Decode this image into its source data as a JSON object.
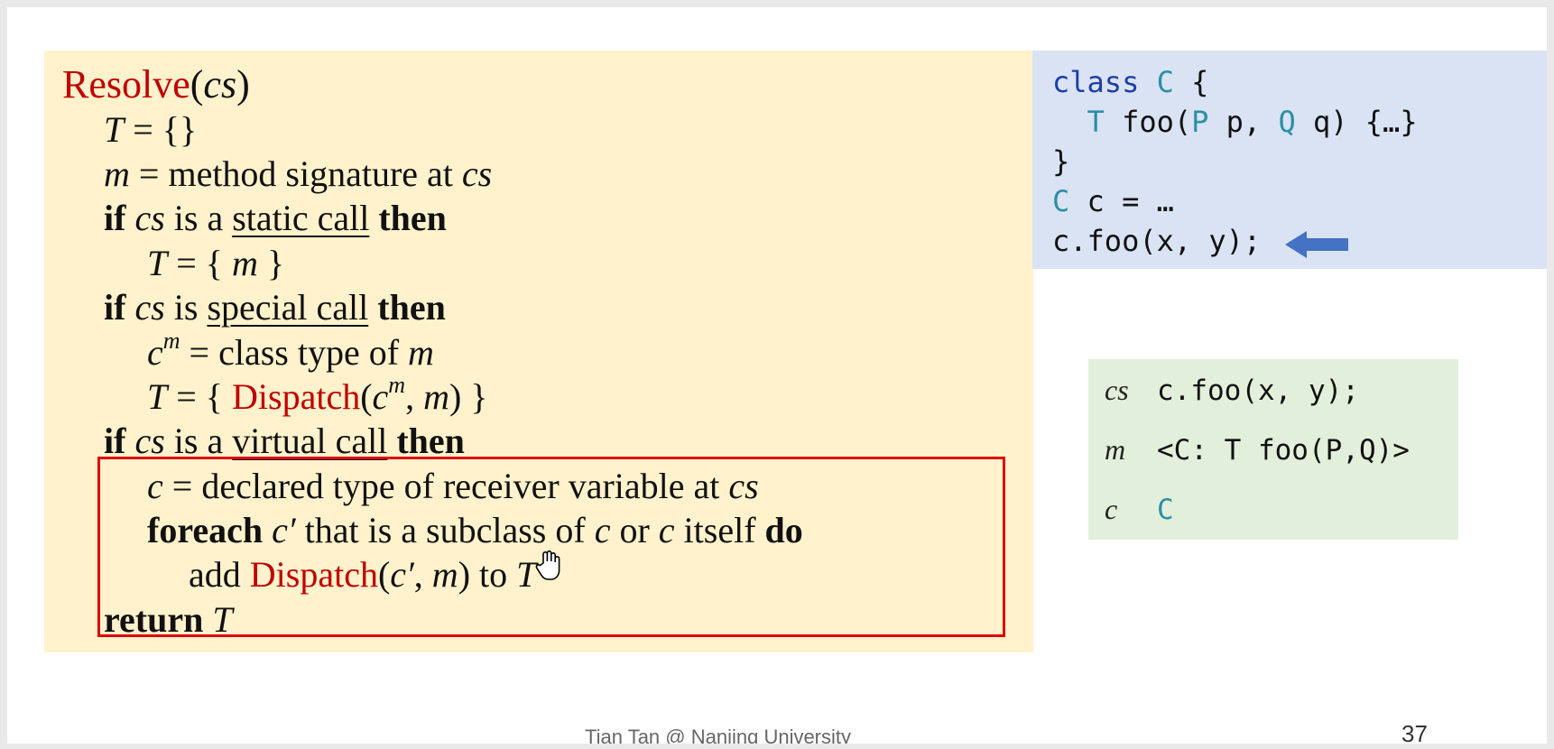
{
  "algorithm": {
    "title_fn": "Resolve",
    "title_arg": "cs",
    "l1_T": "T",
    "l1_rest": " = {}",
    "l2_m": "m",
    "l2_rest": " = method signature at ",
    "l2_cs": "cs",
    "if_kw": "if",
    "then_kw": "then",
    "static_is": " is a ",
    "static_call": "static call",
    "special_is": " is ",
    "special_call": "special call",
    "virtual_is": " is a ",
    "virtual_call": "virtual call",
    "cs": "cs",
    "T": "T",
    "m": "m",
    "c": "c",
    "cm_sup": "m",
    "l5_rest": " = { ",
    "l5_end": " }",
    "l7_rest": " = class type of ",
    "l8_rest": " = { ",
    "dispatch": "Dispatch",
    "l8_end": ") }",
    "l10_rest": " = declared type of receiver variable at ",
    "foreach_kw": "foreach",
    "cprime": "c′",
    "l11_mid": " that is a subclass of ",
    "l11_or": " or ",
    "l11_itself": " itself ",
    "do_kw": "do",
    "add": "add ",
    "to": " to ",
    "return_kw": "return"
  },
  "code": {
    "line1_kw": "class",
    "line1_type": "C",
    "line1_brace": " {",
    "line2_type_T": "T",
    "line2_mid": " foo(",
    "line2_type_P": "P",
    "line2_p": " p, ",
    "line2_type_Q": "Q",
    "line2_end": " q) {…}",
    "line3": "}",
    "line4_type": "C",
    "line4_rest": " c = …",
    "line5": "c.foo(x, y);"
  },
  "vars": {
    "cs_key": "cs",
    "cs_val": "c.foo(x, y);",
    "m_key": "m",
    "m_val": "<C: T foo(P,Q)>",
    "c_key": "c",
    "c_val": "C"
  },
  "footer": "Tian Tan @ Nanjing University",
  "page_number": "37",
  "colors": {
    "algo_bg": "#fff2cc",
    "code_bg": "#dae3f3",
    "vars_bg": "#e2efda",
    "highlight_red": "#c00000",
    "box_border": "#e00000",
    "arrow": "#4472c4"
  }
}
